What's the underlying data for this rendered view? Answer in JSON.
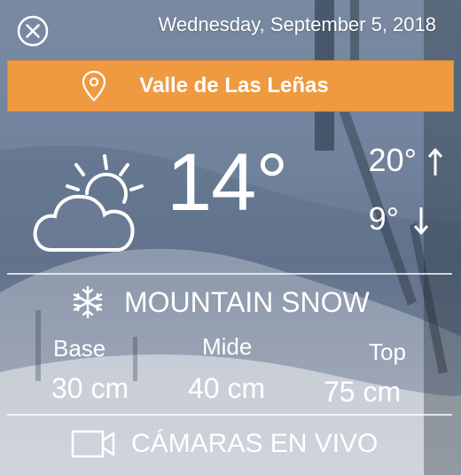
{
  "header": {
    "date": "Wednesday, September 5, 2018"
  },
  "location": {
    "name": "Valle de Las Leñas"
  },
  "weather": {
    "temperature": "14°",
    "high": "20°",
    "low": "9°",
    "icon": "partly-cloudy-icon"
  },
  "snow": {
    "title": "MOUNTAIN SNOW",
    "base_label": "Base",
    "base_value": "30 cm",
    "mid_label": "Mide",
    "mid_value": "40 cm",
    "top_label": "Top",
    "top_value": "75 cm"
  },
  "cameras": {
    "label": "CÁMARAS EN VIVO"
  },
  "colors": {
    "accent": "#ef9a40"
  }
}
